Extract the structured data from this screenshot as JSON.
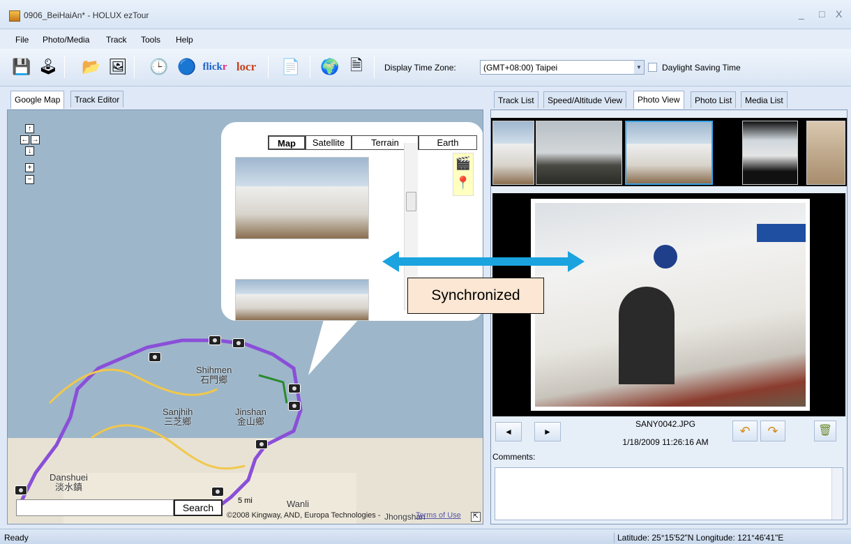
{
  "window": {
    "title": "0906_BeiHaiAn* - HOLUX ezTour",
    "minimize": "_",
    "maximize": "□",
    "close": "X"
  },
  "menu": {
    "file": "File",
    "photo_media": "Photo/Media",
    "track": "Track",
    "tools": "Tools",
    "help": "Help"
  },
  "toolbar": {
    "flickr_a": "flick",
    "flickr_b": "r",
    "locr": "locr",
    "time_zone_label": "Display Time Zone:",
    "time_zone_value": "(GMT+08:00) Taipei",
    "dst_label": "Daylight Saving Time"
  },
  "left_tabs": [
    "Google Map",
    "Track Editor"
  ],
  "right_tabs": [
    "Track List",
    "Speed/Altitude View",
    "Photo View",
    "Photo List",
    "Media List"
  ],
  "map": {
    "map_types": [
      "Map",
      "Satellite",
      "Terrain",
      "Earth"
    ],
    "labels": {
      "shihmen": "Shihmen",
      "shihmen_cn": "石門鄉",
      "sanjhih": "Sanjhih",
      "sanjhih_cn": "三芝鄉",
      "jinshan": "Jinshan",
      "jinshan_cn": "金山鄉",
      "danshuei": "Danshuei",
      "danshuei_cn": "淡水鎮",
      "wanli": "Wanli",
      "jhongshan": "Jhongshan"
    },
    "search_button": "Search",
    "scale": "5 mi",
    "attribution": "©2008 Kingway, AND, Europa Technologies -",
    "terms": "Terms of Use"
  },
  "photo_view": {
    "filename": "SANY0042.JPG",
    "datetime": "1/18/2009 11:26:16 AM",
    "comments_label": "Comments:"
  },
  "annotation": {
    "sync_label": "Synchronized"
  },
  "status": {
    "left": "Ready",
    "right": "Latitude: 25°15'52\"N Longitude: 121°46'41\"E"
  }
}
